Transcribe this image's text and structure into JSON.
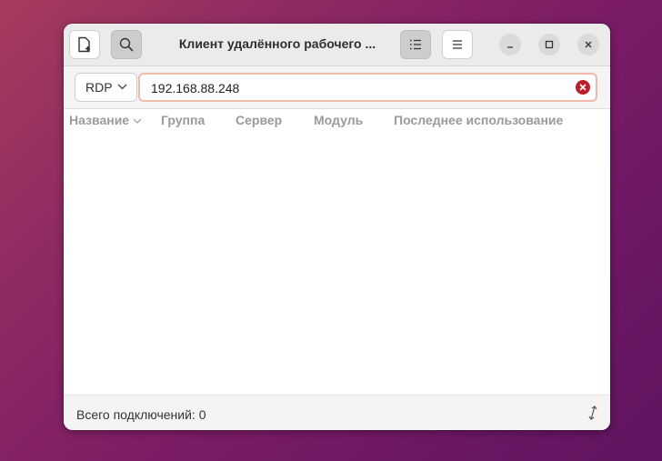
{
  "window": {
    "title": "Клиент удалённого рабочего ..."
  },
  "toolbar": {
    "protocol": "RDP",
    "address_value": "192.168.88.248"
  },
  "columns": [
    {
      "label": "Название",
      "sorted": true
    },
    {
      "label": "Группа"
    },
    {
      "label": "Сервер"
    },
    {
      "label": "Модуль"
    },
    {
      "label": "Последнее использование"
    }
  ],
  "connections": [],
  "status": {
    "text": "Всего подключений: 0"
  },
  "colors": {
    "accent_focus": "#f0b9a6",
    "clear_button": "#c01c28",
    "desktop_gradient_start": "#a63b5e",
    "desktop_gradient_end": "#5f155f"
  },
  "icons": [
    "new-connection-icon",
    "search-icon",
    "list-view-icon",
    "hamburger-menu-icon",
    "minimize-icon",
    "maximize-icon",
    "close-icon",
    "chevron-down-icon",
    "clear-icon",
    "sort-down-icon",
    "resize-icon"
  ]
}
